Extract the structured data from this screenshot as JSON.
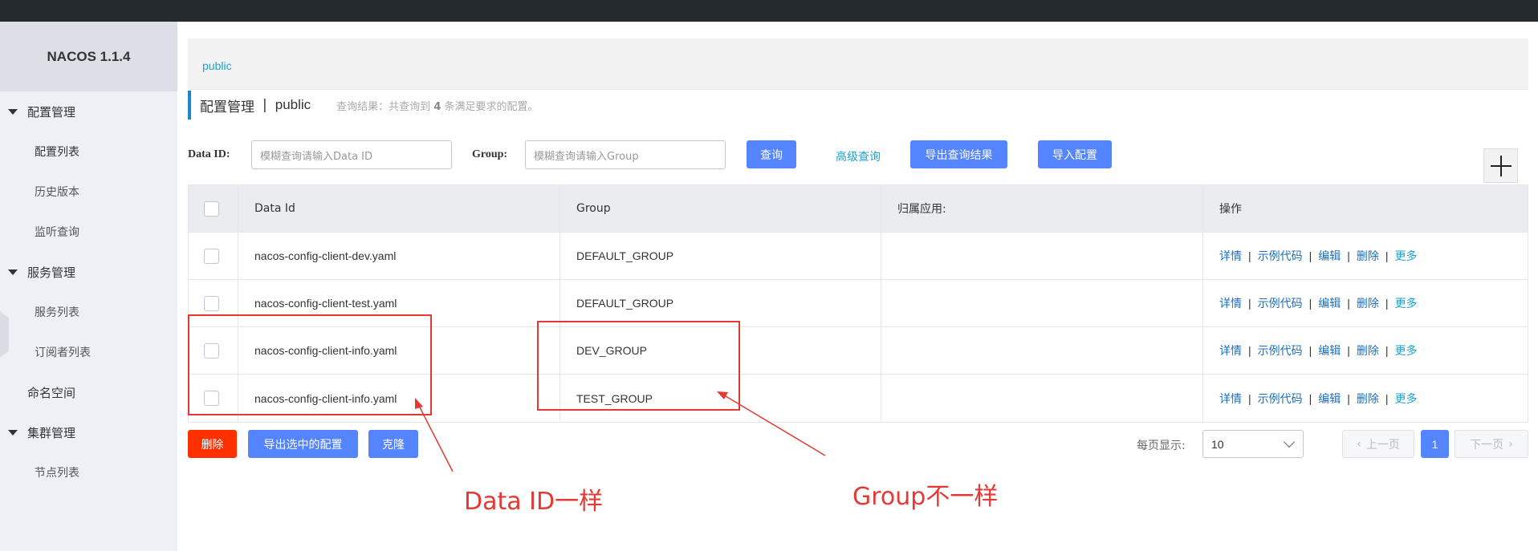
{
  "sidebar": {
    "brand": "NACOS 1.1.4",
    "items": [
      {
        "label": "配置管理"
      },
      {
        "label": "配置列表"
      },
      {
        "label": "历史版本"
      },
      {
        "label": "监听查询"
      },
      {
        "label": "服务管理"
      },
      {
        "label": "服务列表"
      },
      {
        "label": "订阅者列表"
      },
      {
        "label": "命名空间"
      },
      {
        "label": "集群管理"
      },
      {
        "label": "节点列表"
      }
    ]
  },
  "namespace_bar": {
    "current": "public"
  },
  "header": {
    "title": "配置管理",
    "separator": "|",
    "namespace": "public",
    "hint_prefix": "查询结果：共查询到",
    "hint_count": "4",
    "hint_suffix": "条满足要求的配置。"
  },
  "search": {
    "data_id_label": "Data ID:",
    "data_id_placeholder": "模糊查询请输入Data ID",
    "group_label": "Group:",
    "group_placeholder": "模糊查询请输入Group",
    "query_button": "查询",
    "advanced_link": "高级查询",
    "export_results_button": "导出查询结果",
    "import_button": "导入配置"
  },
  "table": {
    "columns": [
      "Data Id",
      "Group",
      "归属应用:",
      "操作"
    ],
    "rows": [
      {
        "data_id": "nacos-config-client-dev.yaml",
        "group": "DEFAULT_GROUP",
        "app": ""
      },
      {
        "data_id": "nacos-config-client-test.yaml",
        "group": "DEFAULT_GROUP",
        "app": ""
      },
      {
        "data_id": "nacos-config-client-info.yaml",
        "group": "DEV_GROUP",
        "app": ""
      },
      {
        "data_id": "nacos-config-client-info.yaml",
        "group": "TEST_GROUP",
        "app": ""
      }
    ],
    "actions": {
      "detail": "详情",
      "sample": "示例代码",
      "edit": "编辑",
      "delete": "删除",
      "more": "更多",
      "sep": "|"
    }
  },
  "bottom": {
    "delete_button": "删除",
    "export_selected_button": "导出选中的配置",
    "clone_button": "克隆",
    "per_page_label": "每页显示:",
    "per_page_value": "10",
    "prev_button": "上一页",
    "current_page": "1",
    "next_button": "下一页"
  },
  "annotations": {
    "left_note": "Data ID一样",
    "right_note": "Group不一样",
    "color": "#e53935"
  },
  "colors": {
    "primary": "#5584ff",
    "danger": "#ff3000",
    "link": "#1aa3d1",
    "topbar": "#252a2f"
  }
}
